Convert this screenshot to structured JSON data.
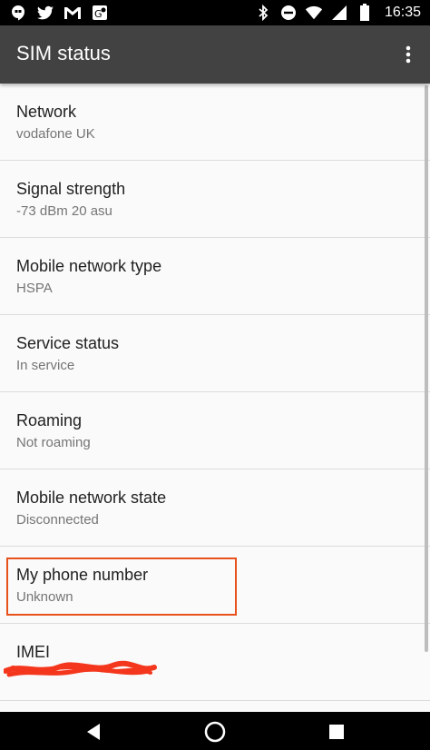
{
  "status_bar": {
    "time": "16:35",
    "left_icons": [
      "hangouts-icon",
      "twitter-icon",
      "gmail-icon",
      "maps-icon"
    ],
    "right_icons": [
      "bluetooth-icon",
      "do-not-disturb-icon",
      "wifi-icon",
      "signal-icon",
      "battery-icon"
    ]
  },
  "app_bar": {
    "title": "SIM status",
    "overflow_icon": "more-vert-icon",
    "background": "#424242"
  },
  "rows": [
    {
      "title": "Network",
      "value": "vodafone UK"
    },
    {
      "title": "Signal strength",
      "value": "-73 dBm 20 asu"
    },
    {
      "title": "Mobile network type",
      "value": "HSPA"
    },
    {
      "title": "Service status",
      "value": "In service"
    },
    {
      "title": "Roaming",
      "value": "Not roaming"
    },
    {
      "title": "Mobile network state",
      "value": "Disconnected"
    },
    {
      "title": "My phone number",
      "value": "Unknown"
    },
    {
      "title": "IMEI",
      "value": ""
    }
  ],
  "highlight_color": "#e8501c",
  "nav_bar": {
    "icons": [
      "back-icon",
      "home-icon",
      "recents-icon"
    ]
  }
}
